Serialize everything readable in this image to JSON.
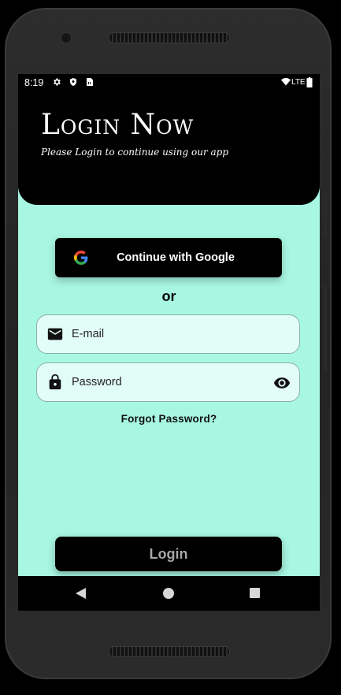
{
  "status_bar": {
    "time": "8:19",
    "network": "LTE",
    "left_icons": [
      "gear-icon",
      "shield-icon",
      "sim-card-icon"
    ],
    "right_icons": [
      "wifi-icon",
      "battery-icon"
    ]
  },
  "header": {
    "title": "Login Now",
    "subtitle": "Please Login to continue using our app"
  },
  "google_button": {
    "label": "Continue with Google",
    "icon": "google-icon"
  },
  "divider_text": "or",
  "email_field": {
    "placeholder": "E-mail",
    "value": "",
    "icon": "mail-icon"
  },
  "password_field": {
    "placeholder": "Password",
    "value": "",
    "icon": "lock-icon",
    "toggle_icon": "eye-icon"
  },
  "forgot_password": "Forgot Password?",
  "login_button": "Login",
  "navigation": [
    "back-icon",
    "home-icon",
    "recent-apps-icon"
  ],
  "colors": {
    "background": "#a8f7e3",
    "header": "#000000",
    "field_bg": "#e2fdf7",
    "button_bg": "#000000",
    "login_text": "#a7a7a7"
  }
}
